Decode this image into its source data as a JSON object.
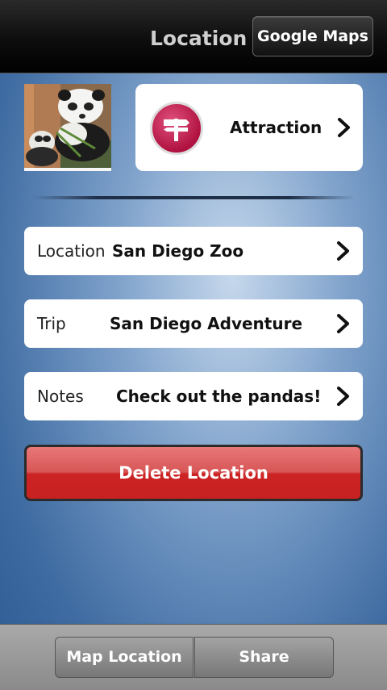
{
  "header": {
    "title": "Location",
    "google_maps_label": "Google Maps"
  },
  "type_card": {
    "label": "Attraction",
    "icon": "signpost-icon",
    "icon_color": "#c0174a"
  },
  "rows": [
    {
      "label": "Location",
      "value": "San Diego Zoo"
    },
    {
      "label": "Trip",
      "value": "San Diego Adventure"
    },
    {
      "label": "Notes",
      "value": "Check out the pandas!"
    }
  ],
  "delete_button": {
    "label": "Delete Location",
    "color": "#d03030"
  },
  "bottom_bar": {
    "map_location_label": "Map Location",
    "share_label": "Share"
  }
}
